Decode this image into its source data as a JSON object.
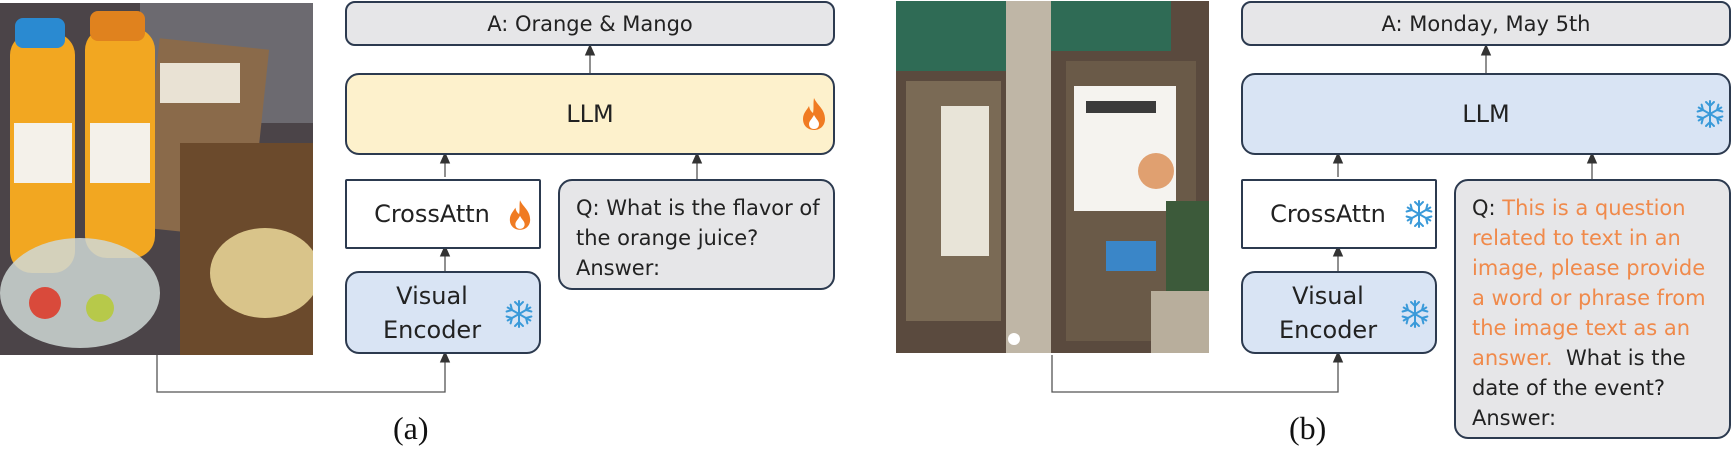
{
  "panel_a": {
    "answer": "A: Orange & Mango",
    "llm": "LLM",
    "cross_attn": "CrossAttn",
    "visual_encoder_line1": "Visual",
    "visual_encoder_line2": "Encoder",
    "question": "Q: What is the flavor of the orange juice? Answer:",
    "caption": "(a)",
    "llm_icon": "flame-icon",
    "cross_attn_icon": "flame-icon",
    "encoder_icon": "snowflake-icon"
  },
  "panel_b": {
    "answer": "A: Monday, May 5th",
    "llm": "LLM",
    "cross_attn": "CrossAttn",
    "visual_encoder_line1": "Visual",
    "visual_encoder_line2": "Encoder",
    "question_prefix": "Q: ",
    "question_prompt": "This is a question related to text in an image, please provide a word or phrase from the image text as an answer.",
    "question_rest": "  What is the date of the event? Answer:",
    "caption": "(b)",
    "llm_icon": "snowflake-icon",
    "cross_attn_icon": "snowflake-icon",
    "encoder_icon": "snowflake-icon"
  },
  "colors": {
    "trainable_fill": "#fdf1cc",
    "frozen_fill": "#d9e4f4",
    "answer_fill": "#e6e6e8",
    "prompt_text": "#f08a4b",
    "flame": "#f07b22",
    "snowflake": "#3a9ad9"
  }
}
